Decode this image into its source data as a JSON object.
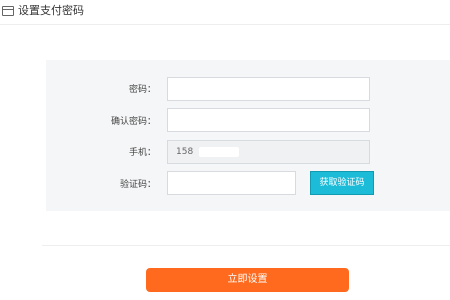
{
  "header": {
    "title": "设置支付密码",
    "icon": "card-icon"
  },
  "form": {
    "password_label": "密码：",
    "password_value": "",
    "confirm_label": "确认密码：",
    "confirm_value": "",
    "phone_label": "手机：",
    "phone_value": "158",
    "code_label": "验证码：",
    "code_value": "",
    "get_code_button": "获取验证码"
  },
  "submit_label": "立即设置",
  "colors": {
    "accent_orange": "#ff6a1e",
    "accent_cyan": "#1cbbd8"
  }
}
